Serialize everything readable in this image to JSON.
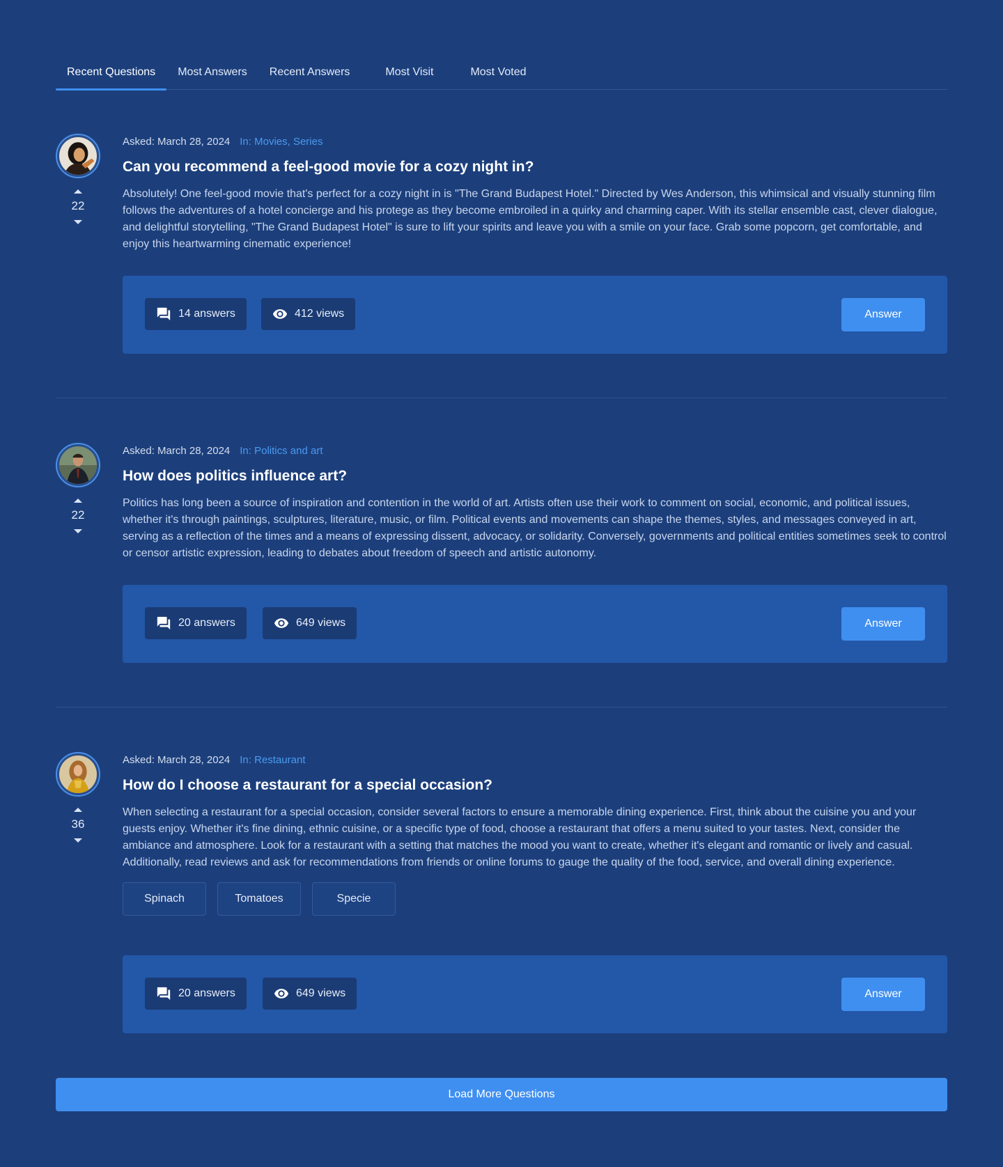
{
  "tabs": [
    {
      "label": "Recent Questions",
      "active": true
    },
    {
      "label": "Most Answers"
    },
    {
      "label": "Recent Answers"
    },
    {
      "label": "Most Visit"
    },
    {
      "label": "Most Voted"
    }
  ],
  "questions": [
    {
      "asked": "Asked: March 28, 2024",
      "category": "In: Movies, Series",
      "title": "Can you recommend a feel-good movie for a cozy night in?",
      "text": "Absolutely! One feel-good movie that's perfect for a cozy night in is \"The Grand Budapest Hotel.\" Directed by Wes Anderson, this whimsical and visually stunning film follows the adventures of a hotel concierge and his protege as they become embroiled in a quirky and charming caper. With its stellar ensemble cast, clever dialogue, and delightful storytelling, \"The Grand Budapest Hotel\" is sure to lift your spirits and leave you with a smile on your face. Grab some popcorn, get comfortable, and enjoy this heartwarming cinematic experience!",
      "votes": "22",
      "answers": "14 answers",
      "views": "412 views",
      "answer_label": "Answer"
    },
    {
      "asked": "Asked: March 28, 2024",
      "category": "In: Politics and art",
      "title": "How does politics influence art?",
      "text": "Politics has long been a source of inspiration and contention in the world of art. Artists often use their work to comment on social, economic, and political issues, whether it's through paintings, sculptures, literature, music, or film. Political events and movements can shape the themes, styles, and messages conveyed in art, serving as a reflection of the times and a means of expressing dissent, advocacy, or solidarity. Conversely, governments and political entities sometimes seek to control or censor artistic expression, leading to debates about freedom of speech and artistic autonomy.",
      "votes": "22",
      "answers": "20 answers",
      "views": "649 views",
      "answer_label": "Answer"
    },
    {
      "asked": "Asked: March 28, 2024",
      "category": "In: Restaurant",
      "title": "How do I choose a restaurant for a special occasion?",
      "text": "When selecting a restaurant for a special occasion, consider several factors to ensure a memorable dining experience. First, think about the cuisine you and your guests enjoy. Whether it's fine dining, ethnic cuisine, or a specific type of food, choose a restaurant that offers a menu suited to your tastes. Next, consider the ambiance and atmosphere. Look for a restaurant with a setting that matches the mood you want to create, whether it's elegant and romantic or lively and casual. Additionally, read reviews and ask for recommendations from friends or online forums to gauge the quality of the food, service, and overall dining experience.",
      "votes": "36",
      "tags": [
        "Spinach",
        "Tomatoes",
        "Specie"
      ],
      "answers": "20 answers",
      "views": "649 views",
      "answer_label": "Answer"
    }
  ],
  "load_more": "Load More Questions",
  "colors": {
    "background": "#1c3f7c",
    "panel": "#2357a8",
    "accent": "#3f8ff0",
    "category": "#4a9af0"
  }
}
